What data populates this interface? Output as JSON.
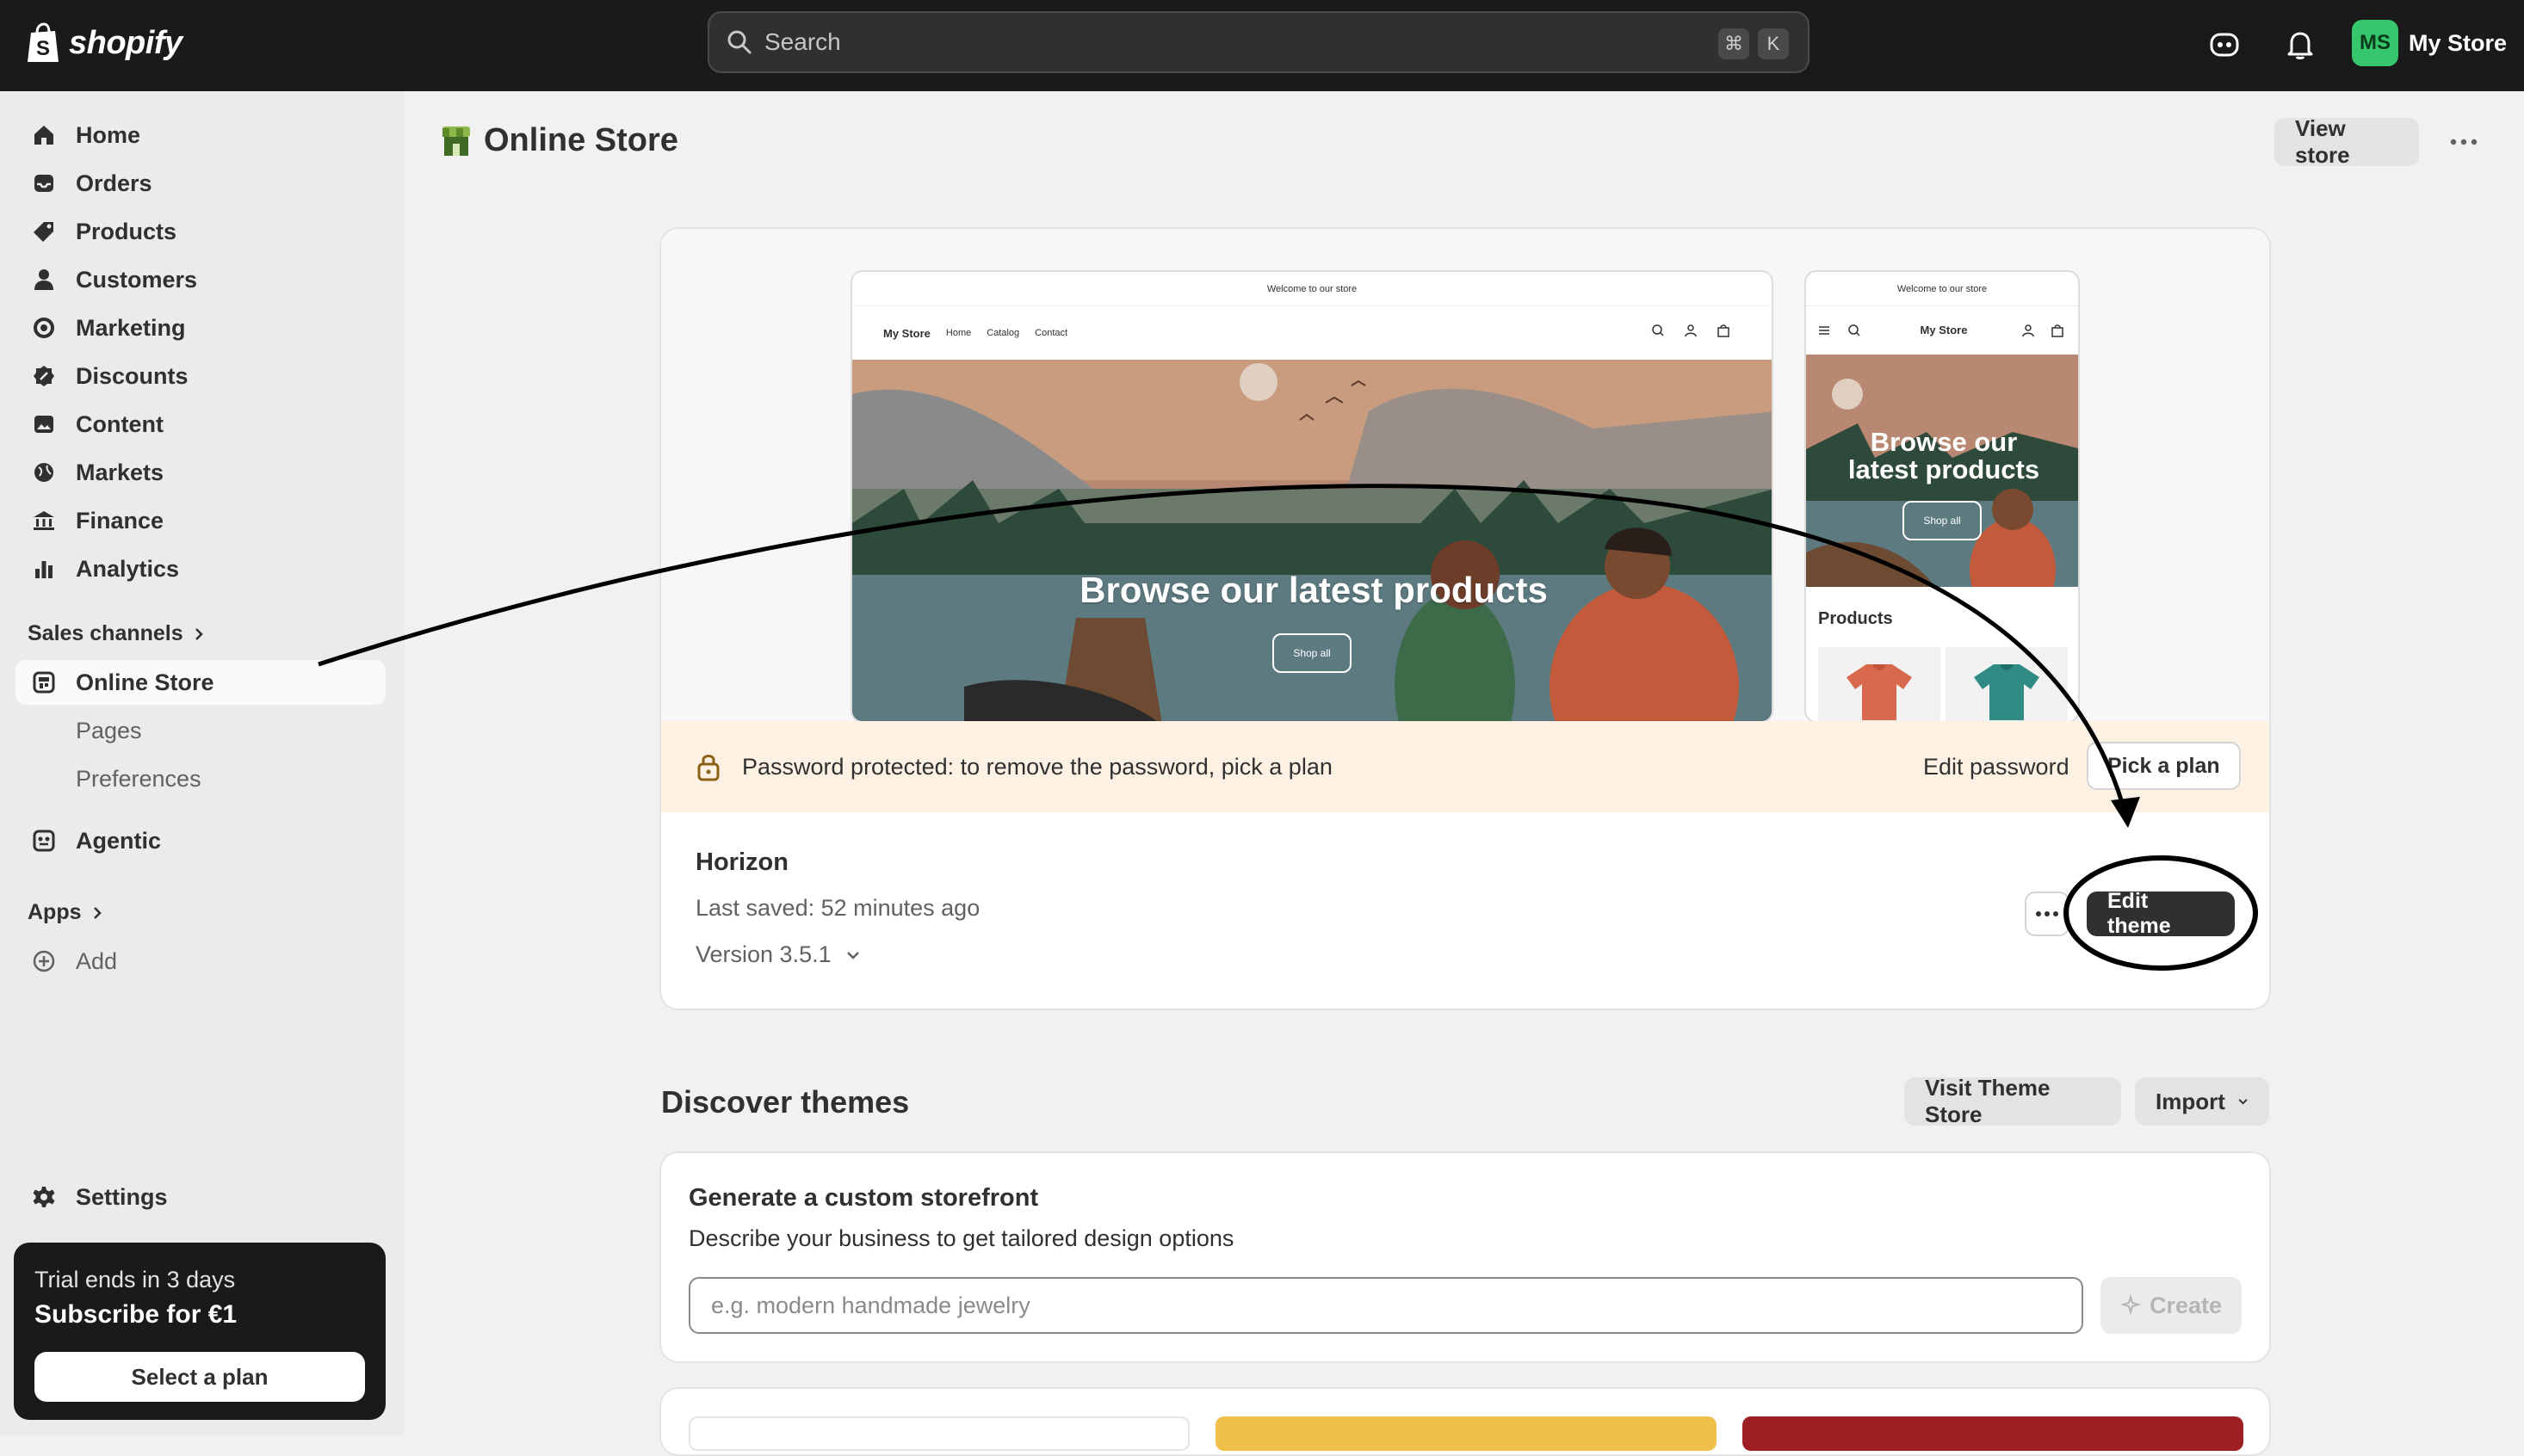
{
  "topbar": {
    "logo_text": "shopify",
    "search_placeholder": "Search",
    "shortcut_cmd": "⌘",
    "shortcut_key": "K",
    "avatar_initials": "MS",
    "store_name": "My Store"
  },
  "sidebar": {
    "items": [
      {
        "label": "Home",
        "icon": "home-icon"
      },
      {
        "label": "Orders",
        "icon": "inbox-icon"
      },
      {
        "label": "Products",
        "icon": "tag-icon"
      },
      {
        "label": "Customers",
        "icon": "person-icon"
      },
      {
        "label": "Marketing",
        "icon": "target-icon"
      },
      {
        "label": "Discounts",
        "icon": "discount-icon"
      },
      {
        "label": "Content",
        "icon": "image-icon"
      },
      {
        "label": "Markets",
        "icon": "globe-icon"
      },
      {
        "label": "Finance",
        "icon": "bank-icon"
      },
      {
        "label": "Analytics",
        "icon": "bar-chart-icon"
      }
    ],
    "sales_channels_label": "Sales channels",
    "online_store_label": "Online Store",
    "pages_label": "Pages",
    "preferences_label": "Preferences",
    "agentic_label": "Agentic",
    "apps_label": "Apps",
    "add_label": "Add",
    "settings_label": "Settings",
    "trial": {
      "line1": "Trial ends in 3 days",
      "line2": "Subscribe for €1",
      "button": "Select a plan"
    }
  },
  "header": {
    "title": "Online Store",
    "view_store_label": "View store"
  },
  "theme_card": {
    "preview_desktop": {
      "announcement": "Welcome to our store",
      "store_name": "My Store",
      "nav": [
        "Home",
        "Catalog",
        "Contact"
      ],
      "hero_text": "Browse our latest products",
      "cta": "Shop all"
    },
    "preview_mobile": {
      "announcement": "Welcome to our store",
      "store_name": "My Store",
      "hero_text": "Browse our latest products",
      "cta": "Shop all",
      "section_title": "Products"
    },
    "banner_text": "Password protected: to remove the password, pick a plan",
    "edit_password_label": "Edit password",
    "pick_plan_label": "Pick a plan",
    "theme_name": "Horizon",
    "last_saved": "Last saved: 52 minutes ago",
    "version": "Version 3.5.1",
    "edit_theme_label": "Edit theme"
  },
  "discover": {
    "title": "Discover themes",
    "visit_store_label": "Visit Theme Store",
    "import_label": "Import"
  },
  "generate": {
    "title": "Generate a custom storefront",
    "subtitle": "Describe your business to get tailored design options",
    "placeholder": "e.g. modern handmade jewelry",
    "create_label": "Create"
  },
  "colors": {
    "topbar_bg": "#1a1a1a",
    "banner_bg": "#fdf1e4",
    "primary_button": "#303030",
    "avatar_bg": "#36c66b"
  }
}
